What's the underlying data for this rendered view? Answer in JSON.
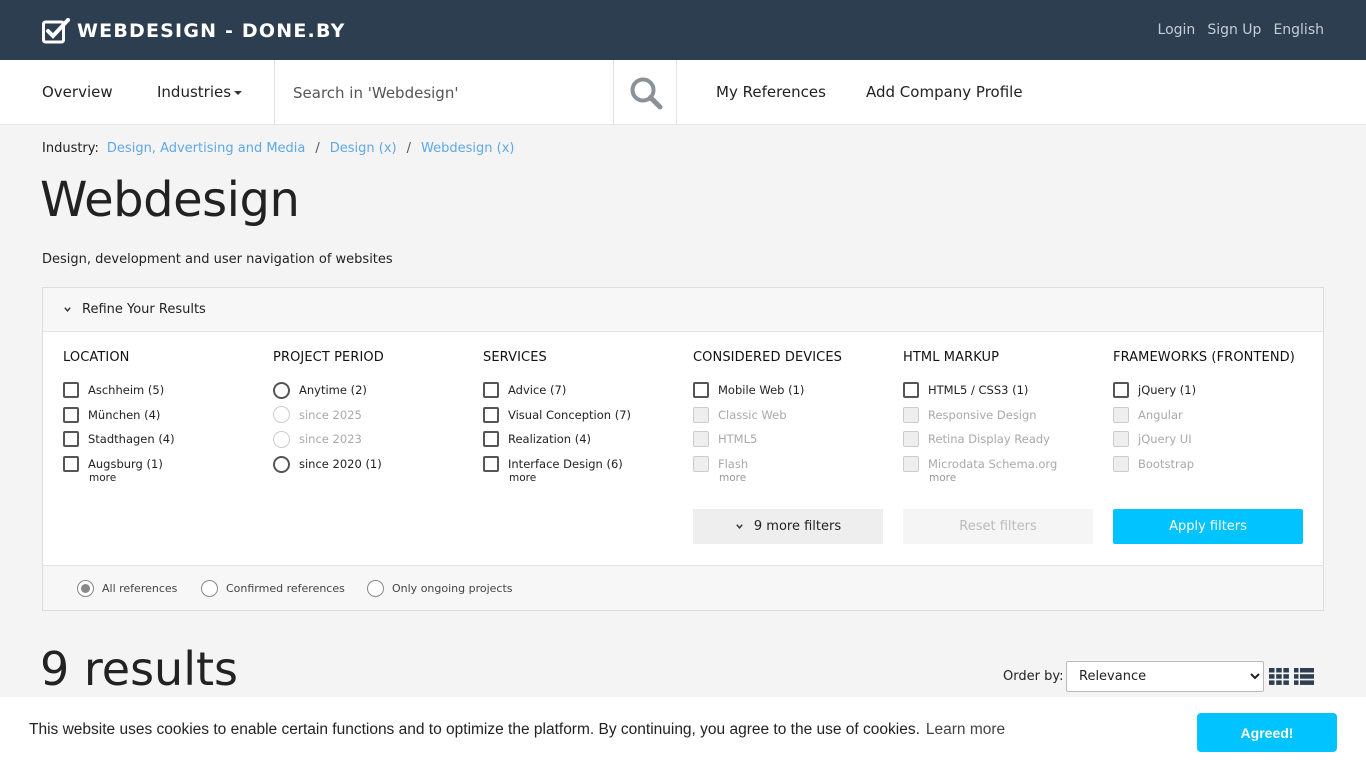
{
  "header": {
    "brand": "WEBDESIGN - DONE.BY",
    "links": [
      "Login",
      "Sign Up",
      "English"
    ]
  },
  "nav": {
    "overview": "Overview",
    "industries": "Industries",
    "search_placeholder": "Search in 'Webdesign'",
    "my_references": "My References",
    "add_company": "Add Company Profile"
  },
  "breadcrumb": {
    "label": "Industry:",
    "items": [
      "Design, Advertising and Media",
      "Design (x)",
      "Webdesign (x)"
    ],
    "separator": "/"
  },
  "page": {
    "title": "Webdesign",
    "description": "Design, development and user navigation of websites"
  },
  "refine": {
    "heading": "Refine Your Results",
    "columns": [
      {
        "title": "LOCATION",
        "type": "checkbox",
        "options": [
          {
            "label": "Aschheim (5)",
            "disabled": false
          },
          {
            "label": "München (4)",
            "disabled": false
          },
          {
            "label": "Stadthagen (4)",
            "disabled": false
          },
          {
            "label": "Augsburg (1)",
            "disabled": false
          }
        ],
        "more": "more"
      },
      {
        "title": "PROJECT PERIOD",
        "type": "radio",
        "options": [
          {
            "label": "Anytime (2)",
            "disabled": false
          },
          {
            "label": "since 2025",
            "disabled": true
          },
          {
            "label": "since 2023",
            "disabled": true
          },
          {
            "label": "since 2020 (1)",
            "disabled": false
          }
        ],
        "more": ""
      },
      {
        "title": "SERVICES",
        "type": "checkbox",
        "options": [
          {
            "label": "Advice (7)",
            "disabled": false
          },
          {
            "label": "Visual Conception (7)",
            "disabled": false
          },
          {
            "label": "Realization (4)",
            "disabled": false
          },
          {
            "label": "Interface Design (6)",
            "disabled": false
          }
        ],
        "more": "more"
      },
      {
        "title": "CONSIDERED DEVICES",
        "type": "checkbox",
        "options": [
          {
            "label": "Mobile Web (1)",
            "disabled": false
          },
          {
            "label": "Classic Web",
            "disabled": true
          },
          {
            "label": "HTML5",
            "disabled": true
          },
          {
            "label": "Flash",
            "disabled": true
          }
        ],
        "more": "more",
        "more_muted": true
      },
      {
        "title": "HTML MARKUP",
        "type": "checkbox",
        "options": [
          {
            "label": "HTML5 / CSS3 (1)",
            "disabled": false
          },
          {
            "label": "Responsive Design",
            "disabled": true
          },
          {
            "label": "Retina Display Ready",
            "disabled": true
          },
          {
            "label": "Microdata Schema.org",
            "disabled": true
          }
        ],
        "more": "more",
        "more_muted": true
      },
      {
        "title": "FRAMEWORKS (FRONTEND)",
        "type": "checkbox",
        "options": [
          {
            "label": "jQuery (1)",
            "disabled": false
          },
          {
            "label": "Angular",
            "disabled": true
          },
          {
            "label": "jQuery UI",
            "disabled": true
          },
          {
            "label": "Bootstrap",
            "disabled": true
          }
        ],
        "more": ""
      }
    ],
    "more_filters": "9 more filters",
    "reset": "Reset filters",
    "apply": "Apply filters",
    "reference_filter": {
      "options": [
        "All references",
        "Confirmed references",
        "Only ongoing projects"
      ],
      "selected": "All references"
    }
  },
  "results": {
    "title": "9 results",
    "order_label": "Order by:",
    "order_options": [
      "Relevance"
    ],
    "order_selected": "Relevance"
  },
  "cookie": {
    "text": "This website uses cookies to enable certain functions and to optimize the platform. By continuing, you agree to the use of cookies.",
    "link": "Learn more",
    "button": "Agreed!"
  },
  "colors": {
    "topbar": "#2c3e50",
    "accent": "#00c3ff",
    "link": "#5fa8e6"
  },
  "icons": {
    "logo": "checkbox-check-icon",
    "search": "search-icon",
    "chevron": "chevron-down-icon",
    "grid_view": "grid-view-icon",
    "list_view": "list-view-icon"
  }
}
